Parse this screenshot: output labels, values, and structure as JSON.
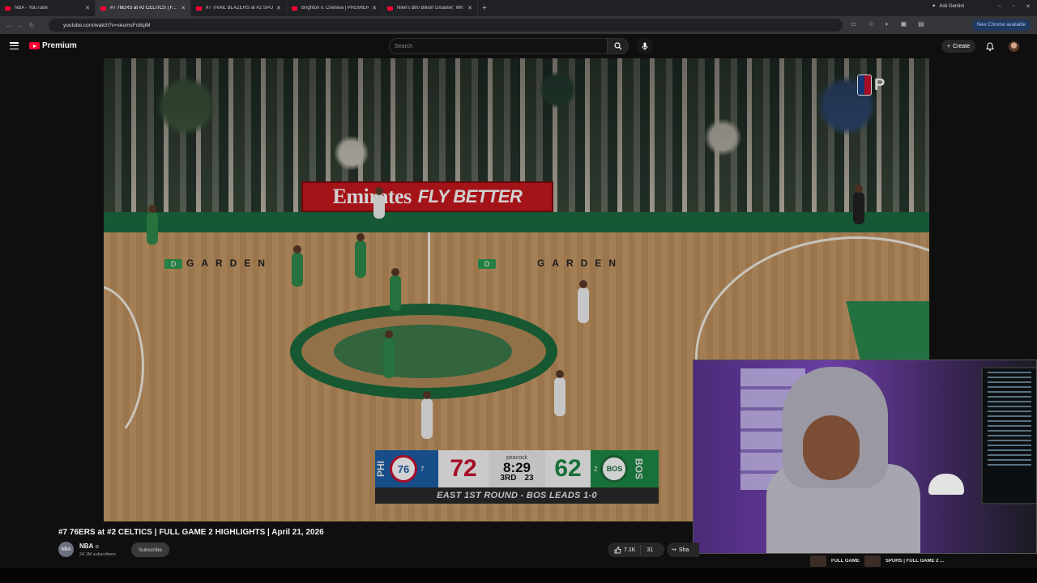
{
  "browser": {
    "tabs": [
      {
        "title": "NBA - YouTube"
      },
      {
        "title": "#7 76ERS at #2 CELTICS | F..."
      },
      {
        "title": "#7 TRAIL BLAZERS at #2 SPUR"
      },
      {
        "title": "Brighton v. Chelsea | PREMIER"
      },
      {
        "title": "Nike's $80 Billion Disaster: Wh"
      }
    ],
    "ask_gemini": "Ask Gemini",
    "url": "youtube.com/watch?v=xeumsFo8qiM",
    "update_label": "New Chrome available"
  },
  "youtube": {
    "logo_text": "Premium",
    "search_placeholder": "Search",
    "create_label": "Create"
  },
  "video": {
    "banner_main": "Emirates",
    "banner_tagline": "FLY BETTER",
    "floor_text": "GARDEN",
    "floor_d": "D",
    "broadcast_mark": "P",
    "scorebug": {
      "away_abbr": "PHI",
      "away_logo": "76",
      "away_seed": "7",
      "away_score": "72",
      "network": "peacock",
      "clock": "8:29",
      "period": "3RD",
      "shot_clock": "23",
      "home_score": "62",
      "home_seed": "2",
      "home_logo": "BOS",
      "home_abbr": "BOS",
      "footer": "EAST 1ST ROUND - BOS LEADS 1-0"
    }
  },
  "meta": {
    "title": "#7 76ERS at #2 CELTICS | FULL GAME 2 HIGHLIGHTS | April 21, 2026",
    "channel_name": "NBA",
    "channel_avatar": "NBA",
    "subscribers": "24.1M subscribers",
    "subscribe_label": "Subscribe",
    "likes": "7.1K",
    "dislike_count": "31",
    "share_label": "Sha"
  },
  "recommendations": [
    {
      "title": "FULL GAME"
    },
    {
      "title": "SPURS | FULL GAME 2 ..."
    }
  ]
}
